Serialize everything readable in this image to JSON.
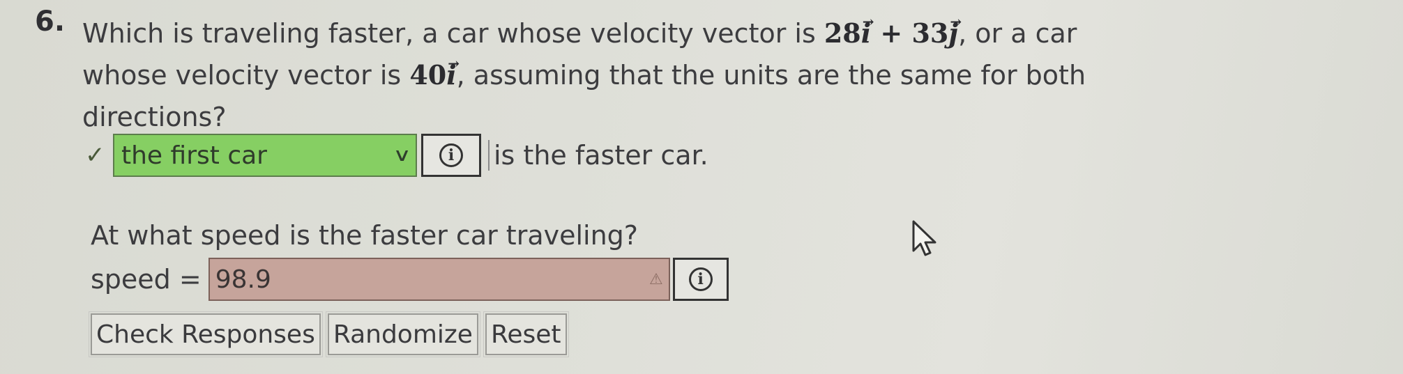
{
  "question": {
    "number": "6.",
    "text_1": "Which is traveling faster, a car whose velocity vector is ",
    "vec1_a": "28",
    "vec1_i": "i",
    "vec1_plus": " + 33",
    "vec1_j": "j",
    "text_2": ", or a car whose velocity vector is ",
    "vec2_a": "40",
    "vec2_i": "i",
    "text_3": ", assuming that the units are the same for both directions?"
  },
  "answer1": {
    "check": "✓",
    "selected": "the first car",
    "chevron": "⌵",
    "info": "i",
    "suffix": "is the faster car."
  },
  "question2": {
    "text": "At what speed is the faster car traveling?"
  },
  "answer2": {
    "label": "speed =",
    "value": "98.9",
    "warn": "⚠",
    "info": "i"
  },
  "buttons": {
    "check": "Check Responses",
    "randomize": "Randomize",
    "reset": "Reset"
  }
}
